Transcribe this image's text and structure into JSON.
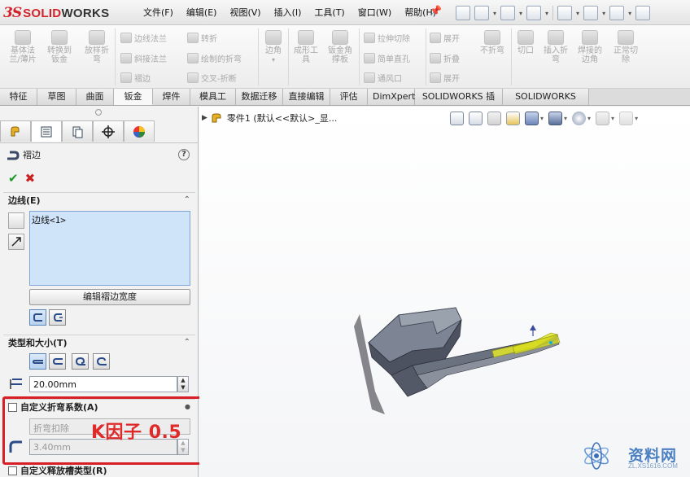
{
  "app": {
    "logo_ds": "3S",
    "logo_solid": "SOLID",
    "logo_works": "WORKS"
  },
  "menu": [
    "文件(F)",
    "编辑(E)",
    "视图(V)",
    "插入(I)",
    "工具(T)",
    "窗口(W)",
    "帮助(H)"
  ],
  "command_manager": {
    "big": [
      {
        "label": "基体法兰/薄片"
      },
      {
        "label": "转换到钣金"
      },
      {
        "label": "放样折弯"
      },
      {
        "label": "边角"
      },
      {
        "label": "成形工具"
      },
      {
        "label": "钣金角撑板"
      },
      {
        "label": "展开"
      },
      {
        "label": "不折弯"
      },
      {
        "label": "切口"
      },
      {
        "label": "插入折弯"
      },
      {
        "label": "焊接的边角"
      },
      {
        "label": "正常切除"
      }
    ],
    "small": [
      "边线法兰",
      "斜接法兰",
      "褶边",
      "转折",
      "绘制的折弯",
      "交叉-折断",
      "拉伸切除",
      "简单直孔",
      "通风口",
      "展开",
      "折叠",
      "展开"
    ]
  },
  "tabs": [
    "特征",
    "草图",
    "曲面",
    "钣金",
    "焊件",
    "模具工具",
    "数据迁移",
    "直接编辑",
    "评估",
    "DimXpert",
    "SOLIDWORKS 插件",
    "SOLIDWORKS MBD"
  ],
  "active_tab": "钣金",
  "property_manager": {
    "title": "褶边",
    "help": "?",
    "edges_group": "边线(E)",
    "edge_item": "边线<1>",
    "edit_width_button": "编辑褶边宽度",
    "type_group": "类型和大小(T)",
    "length_value": "20.00mm",
    "custom_bend_group": "自定义折弯系数(A)",
    "bend_type_value": "折弯扣除",
    "bend_value": "3.40mm",
    "custom_relief_group": "自定义释放槽类型(R)"
  },
  "annotation": {
    "k_factor": "K因子 0.5"
  },
  "graphics": {
    "tree_path": "零件1  (默认<<默认>_显...",
    "model_color": "#5a6270",
    "highlight_color": "#e4e82a"
  },
  "watermark": {
    "text": "资料网",
    "sub": "ZL.XS1616.COM"
  }
}
